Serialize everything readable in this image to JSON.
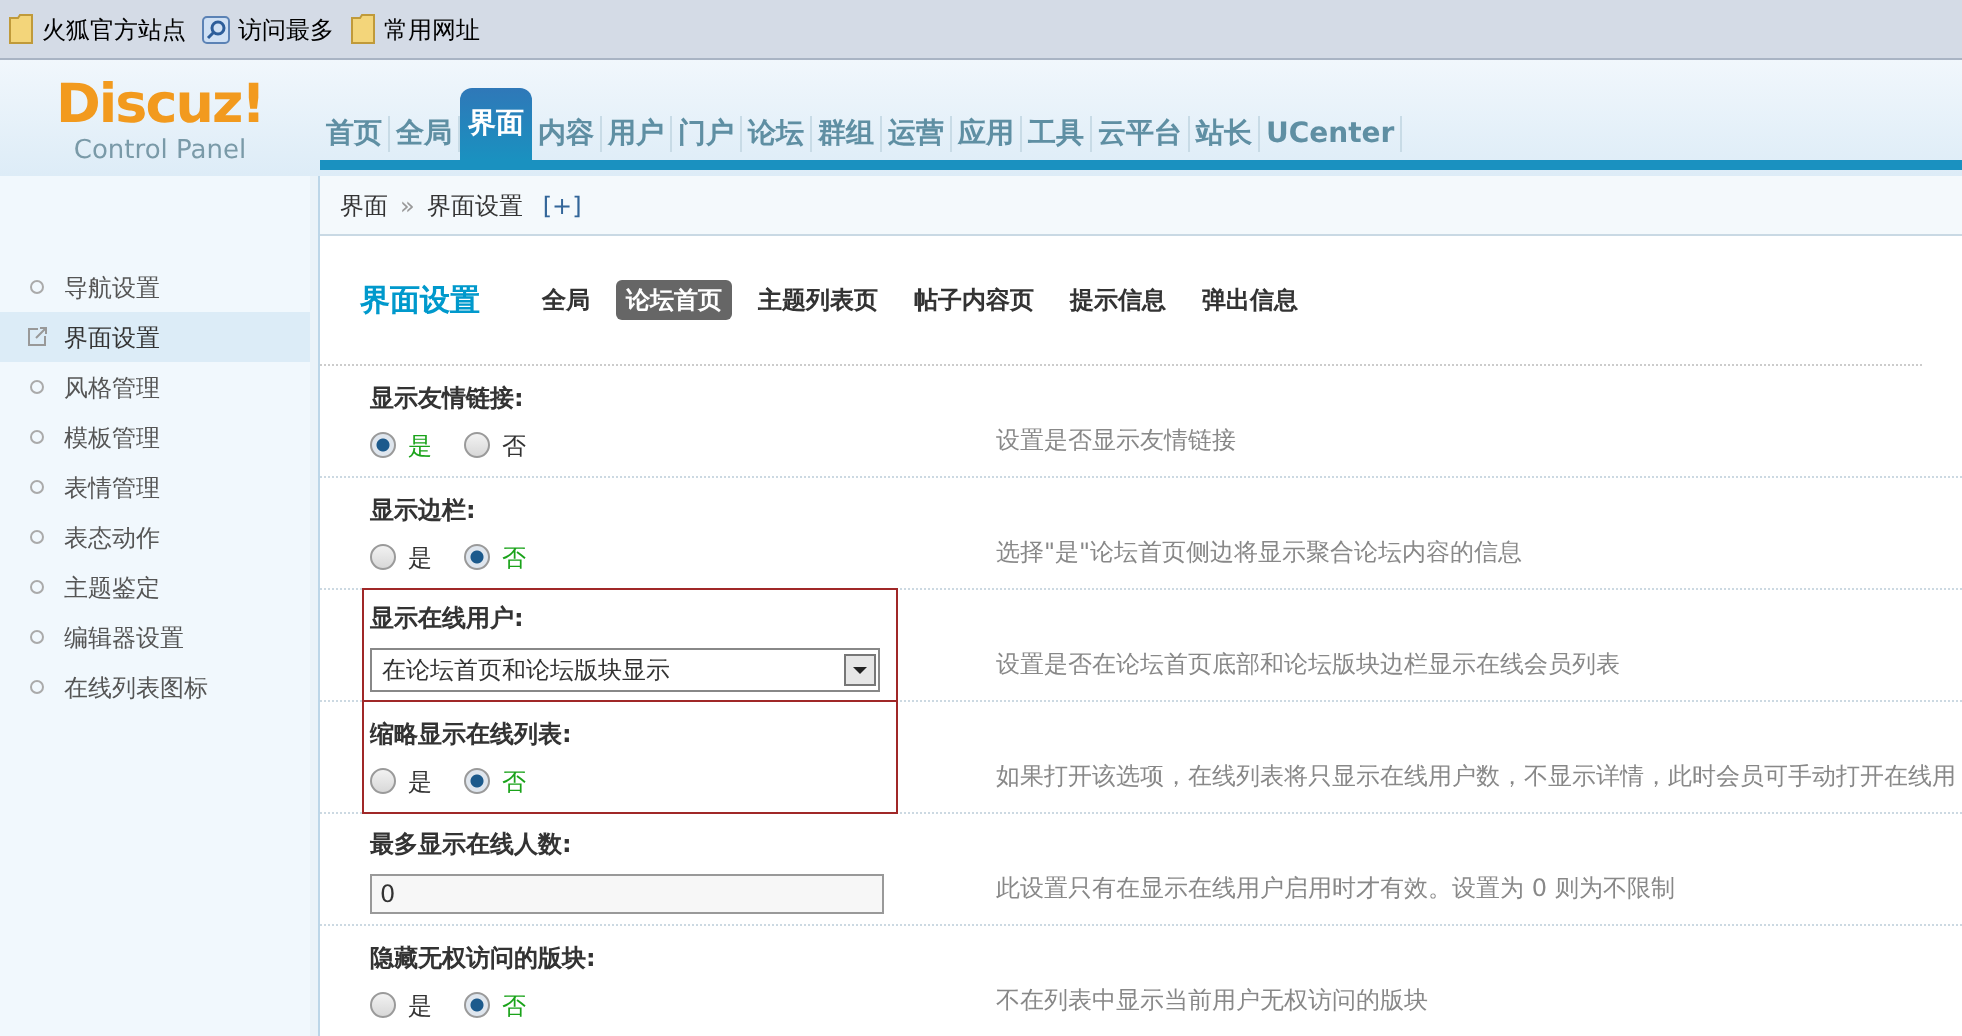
{
  "bookmarks": [
    {
      "label": "火狐官方站点",
      "kind": "folder"
    },
    {
      "label": "访问最多",
      "kind": "search"
    },
    {
      "label": "常用网址",
      "kind": "folder"
    }
  ],
  "logo": {
    "title": "Discuz!",
    "subtitle": "Control Panel"
  },
  "nav": [
    {
      "label": "首页",
      "selected": false
    },
    {
      "label": "全局",
      "selected": false
    },
    {
      "label": "界面",
      "selected": true
    },
    {
      "label": "内容",
      "selected": false
    },
    {
      "label": "用户",
      "selected": false
    },
    {
      "label": "门户",
      "selected": false
    },
    {
      "label": "论坛",
      "selected": false
    },
    {
      "label": "群组",
      "selected": false
    },
    {
      "label": "运营",
      "selected": false
    },
    {
      "label": "应用",
      "selected": false
    },
    {
      "label": "工具",
      "selected": false
    },
    {
      "label": "云平台",
      "selected": false
    },
    {
      "label": "站长",
      "selected": false
    },
    {
      "label": "UCenter",
      "selected": false
    }
  ],
  "breadcrumb": {
    "items": [
      "界面",
      "界面设置"
    ],
    "separator": "»",
    "toggle": "[+]"
  },
  "sidebar": [
    {
      "label": "导航设置",
      "selected": false
    },
    {
      "label": "界面设置",
      "selected": true
    },
    {
      "label": "风格管理",
      "selected": false
    },
    {
      "label": "模板管理",
      "selected": false
    },
    {
      "label": "表情管理",
      "selected": false
    },
    {
      "label": "表态动作",
      "selected": false
    },
    {
      "label": "主题鉴定",
      "selected": false
    },
    {
      "label": "编辑器设置",
      "selected": false
    },
    {
      "label": "在线列表图标",
      "selected": false
    }
  ],
  "page": {
    "title": "界面设置",
    "tabs": [
      {
        "label": "全局",
        "selected": false
      },
      {
        "label": "论坛首页",
        "selected": true
      },
      {
        "label": "主题列表页",
        "selected": false
      },
      {
        "label": "帖子内容页",
        "selected": false
      },
      {
        "label": "提示信息",
        "selected": false
      },
      {
        "label": "弹出信息",
        "selected": false
      }
    ]
  },
  "settings": [
    {
      "label": "显示友情链接:",
      "kind": "radio",
      "options": [
        {
          "label": "是",
          "selected": true
        },
        {
          "label": "否",
          "selected": false
        }
      ],
      "description": "设置是否显示友情链接",
      "highlighted": false
    },
    {
      "label": "显示边栏:",
      "kind": "radio",
      "options": [
        {
          "label": "是",
          "selected": false
        },
        {
          "label": "否",
          "selected": true
        }
      ],
      "description": "选择\"是\"论坛首页侧边将显示聚合论坛内容的信息",
      "highlighted": false
    },
    {
      "label": "显示在线用户:",
      "kind": "select",
      "value": "在论坛首页和论坛版块显示",
      "description": "设置是否在论坛首页底部和论坛版块边栏显示在线会员列表",
      "highlighted": true
    },
    {
      "label": "缩略显示在线列表:",
      "kind": "radio",
      "options": [
        {
          "label": "是",
          "selected": false
        },
        {
          "label": "否",
          "selected": true
        }
      ],
      "description": "如果打开该选项，在线列表将只显示在线用户数，不显示详情，此时会员可手动打开在线用",
      "highlighted": true
    },
    {
      "label": "最多显示在线人数:",
      "kind": "text",
      "value": "0",
      "description": "此设置只有在显示在线用户启用时才有效。设置为 0 则为不限制",
      "highlighted": false
    },
    {
      "label": "隐藏无权访问的版块:",
      "kind": "radio",
      "options": [
        {
          "label": "是",
          "selected": false
        },
        {
          "label": "否",
          "selected": true
        }
      ],
      "description": "不在列表中显示当前用户无权访问的版块",
      "highlighted": false
    }
  ]
}
